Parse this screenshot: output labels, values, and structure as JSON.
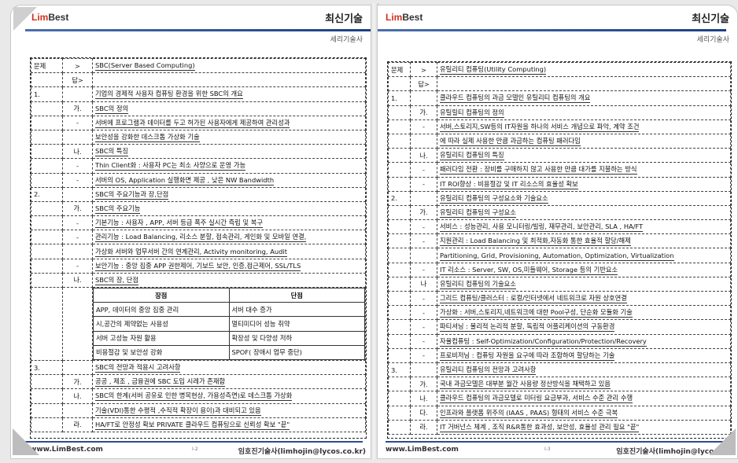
{
  "header": {
    "logo_lim": "Lim",
    "logo_best": "Best",
    "title": "최신기술",
    "subtitle": "세리기술사"
  },
  "footer": {
    "site": "www.LimBest.com",
    "author": "임호진기술사(limhojin@lycos.co.kr)",
    "author_right": "임호진기술사(limhojin@lycos.co.",
    "left_page_num": "I-2",
    "right_page_num": "I-3"
  },
  "left_rows": [
    [
      "문제",
      ">",
      "SBC(Server Based Computing)"
    ],
    [
      "",
      "답>",
      ""
    ],
    [
      "1.",
      "",
      "기업의 경제적 사용자 컴퓨팅 환경을 위한 SBC의 개요"
    ],
    [
      "",
      "가.",
      "SBC의 정의"
    ],
    [
      "",
      "-",
      "서버에 프로그램과 데이터를 두고 허가된 사용자에게 제공하여 관리성과"
    ],
    [
      "",
      "",
      "보안성을 강화한 데스크톱 가상화 기술"
    ],
    [
      "",
      "나.",
      "SBC의 특징"
    ],
    [
      "",
      "-",
      "Thin Client화 : 사용자 PC는 최소 사양으로 운영 가능"
    ],
    [
      "",
      "-",
      "서버의 OS, Application 실행화면 제공 , 낮은 NW Bandwidth"
    ],
    [
      "2.",
      "",
      "SBC의 주요기능과 장,단점"
    ],
    [
      "",
      "가.",
      "SBC의 주요기능"
    ],
    [
      "",
      "-",
      "기본기능 : 사용자 , APP, 서버 등급 폭주 실시간 즉립 및 복구"
    ],
    [
      "",
      "-",
      "관리기능 : Load Balancing, 리소스 분할, 접속관리, 게인화 및 모바일 연결,"
    ],
    [
      "",
      "",
      "가상화 서버와 업무서버 간의 연계관리, Activity monitoring, Audit"
    ],
    [
      "",
      "-",
      "보안기능 : 중앙 집중 APP 권한제어, 기보드 보안, 인증,접근제어, SSL/TLS"
    ],
    [
      "",
      "나.",
      "SBC의 장, 단점"
    ]
  ],
  "left_pros_cons": {
    "headers": [
      "장점",
      "단점"
    ],
    "rows": [
      [
        "APP, 데이터의 중앙 집중 관리",
        "서버 대수 증가"
      ],
      [
        "시,공간의 제약없는 사용성",
        "멀티미디어 성능 취약"
      ],
      [
        "서버 고성능 자원 활용",
        "확장성 및 다양성 저하"
      ],
      [
        "비용절감 및 보안성 강화",
        "SPOF( 장애시 업무 중단)"
      ]
    ]
  },
  "left_rows_after": [
    [
      "3.",
      "",
      "SBC의 전망과 적용시 고려사항"
    ],
    [
      "",
      "가.",
      "공공 , 제조 , 금융권에 SBC 도입 시레가 존재함"
    ],
    [
      "",
      "나.",
      "SBC의 한계(서버 공유로 인한 병목현상, 가용성측면)로 데스크톱 가상화"
    ],
    [
      "",
      "",
      "기술(VDI)통한 수평적 ,수직적 확장이 용이)과 대비되고 있음"
    ],
    [
      "",
      "라.",
      "HA/FT로 안정성 확보 PRIVATE 클라우드 컴퓨팅으로 신뢰성 확보 \"끝\""
    ]
  ],
  "right_rows": [
    [
      "문제",
      ">",
      "유틸리티 컴퓨팅(Utility Computing)"
    ],
    [
      "",
      "답>",
      ""
    ],
    [
      "1.",
      "",
      "클라우드 컴퓨팅의 과금 모델인 유틸리티 컴퓨팅의 개요"
    ],
    [
      "",
      "가.",
      "유틸릴티 컴퓨팅의 정의"
    ],
    [
      "",
      "-",
      "서버,스토리지,SW등의 IT자원을 하나의 서비스 개념으로 파악, 계약 조건"
    ],
    [
      "",
      "",
      "에 따라 실제 사용한 만큼 과금하는 컴퓨팅 패러다임"
    ],
    [
      "",
      "나.",
      "유틸리티 컴퓨팅의 특징"
    ],
    [
      "",
      "-",
      "패러다임 전환 : 장비를 구매하지 않고 사용한 만큼 대가를 지불하는 방식"
    ],
    [
      "",
      "-",
      "IT ROI향상 : 비용절감 및 IT 리소스의 효율성 확보"
    ],
    [
      "2.",
      "",
      "유틸리티 컴퓨팅의 구성요소와 기술요소"
    ],
    [
      "",
      "가.",
      "유틸리티 컴퓨팅의 구성요소"
    ],
    [
      "",
      "-",
      "서비스 : 성능관리, 사용 모니터링/빌링, 재무관리, 보안관리, SLA , HA/FT"
    ],
    [
      "",
      "-",
      "지원관리 : Load Balancing 및 최적화,자동화 통한 효율적 할당/해제"
    ],
    [
      "",
      "",
      "Partitioning, Grid, Provisioning, Automation, Optimization, Virtualization"
    ],
    [
      "",
      "-",
      "IT 리소스 : Server, SW, OS,미들웨어, Storage 등의 기반요소"
    ],
    [
      "",
      "나",
      "유틸리티 컴퓨팅의 기술요소"
    ],
    [
      "",
      "-",
      "그리드 컴퓨팅/클러스터 : 로컬/인터넷에서 네트워크로 자원 상호연결"
    ],
    [
      "",
      "-",
      "가상화 : 서버,스토리지,네트워크에 대한 Pool구성, 단순화 모듈화 기술"
    ],
    [
      "",
      "-",
      "파티셔닝 : 물리적 논리적 분할, 독립적 어플리케이션의 구동환경"
    ],
    [
      "",
      "-",
      "자율컴퓨팅 : Self-Optimization/Configuration/Protection/Recovery"
    ],
    [
      "",
      "-",
      "프로비저닝 : 컴퓨팅 자원을 요구에 따라 조합하여 할당하는 기술"
    ],
    [
      "3.",
      "",
      "유틸리티 컴퓨팅의 전망과 고려사항"
    ],
    [
      "",
      "가.",
      "국내 과금모델은 대부분 월간 사용량 정산방식을 채택하고 있음"
    ],
    [
      "",
      "나.",
      "클라우드 컴퓨팅의 과금모델로 미터링 요금부과, 서비스 수준 관리 수행"
    ],
    [
      "",
      "다.",
      "인프라와 플랫폼 위주의 (IAAS , PAAS) 형태의 서비스 수준 극복"
    ],
    [
      "",
      "라.",
      "IT 거버넌스 체계 , 조직 R&R통한 효과성, 보안성, 효율성 관리 필요 \"끝\""
    ]
  ]
}
